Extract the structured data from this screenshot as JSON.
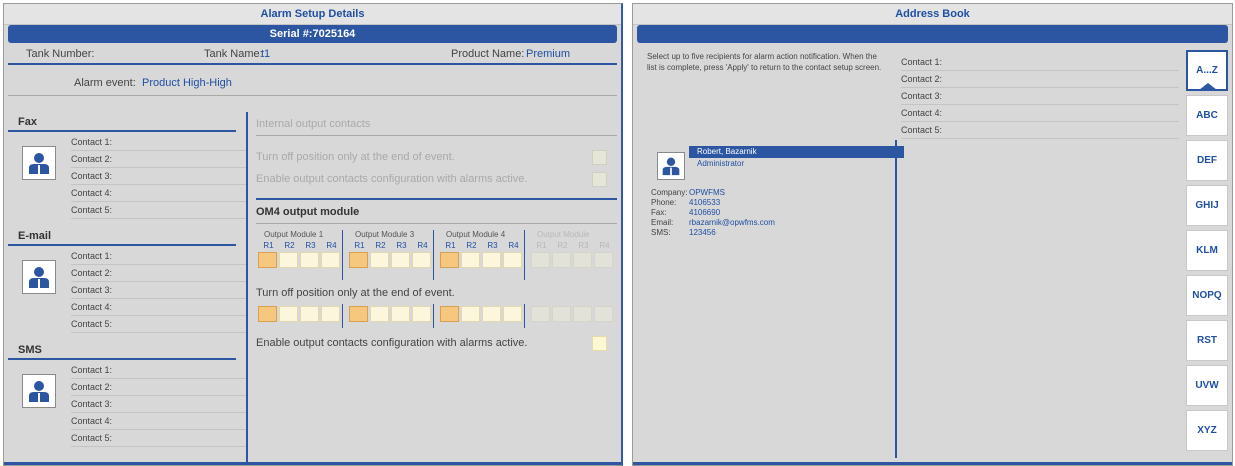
{
  "alarm_setup": {
    "title": "Alarm Setup Details",
    "serial": "Serial #:7025164",
    "tank_number_label": "Tank Number:",
    "tank_name_label": "Tank Name:",
    "tank_name_value": "t1",
    "product_name_label": "Product Name:",
    "product_name_value": "Premium",
    "alarm_event_label": "Alarm event:",
    "alarm_event_value": "Product High-High"
  },
  "notify": {
    "fax": {
      "label": "Fax",
      "contacts": [
        "Contact 1:",
        "Contact 2:",
        "Contact 3:",
        "Contact 4:",
        "Contact 5:"
      ]
    },
    "email": {
      "label": "E-mail",
      "contacts": [
        "Contact 1:",
        "Contact 2:",
        "Contact 3:",
        "Contact 4:",
        "Contact 5:"
      ]
    },
    "sms": {
      "label": "SMS",
      "contacts": [
        "Contact 1:",
        "Contact 2:",
        "Contact 3:",
        "Contact 4:",
        "Contact 5:"
      ]
    }
  },
  "internal": {
    "title": "Internal output contacts",
    "opt1": "Turn off position only at the end of event.",
    "opt2": "Enable output contacts configuration with alarms active."
  },
  "om4": {
    "title": "OM4 output module",
    "modules": [
      "Output Module 1",
      "Output Module 3",
      "Output Module 4",
      "Output Module"
    ],
    "relays": [
      "R1",
      "R2",
      "R3",
      "R4"
    ],
    "turn_off_label": "Turn off position only at the end of event.",
    "enable_label": "Enable output contacts configuration with alarms active."
  },
  "address_book": {
    "title": "Address Book",
    "description": "Select up to five recipients for alarm action notification. When the list is complete, press 'Apply' to return to the contact setup screen.",
    "contacts": [
      "Contact 1:",
      "Contact 2:",
      "Contact 3:",
      "Contact 4:",
      "Contact 5:"
    ],
    "entry": {
      "name": "Robert, Bazarnik",
      "role": "Administrator",
      "company_label": "Company:",
      "company": "OPWFMS",
      "phone_label": "Phone:",
      "phone": "4106533",
      "fax_label": "Fax:",
      "fax": "4106690",
      "email_label": "Email:",
      "email": "rbazarnik@opwfms.com",
      "sms_label": "SMS:",
      "sms": "123456"
    },
    "alpha_tabs": [
      "A...Z",
      "ABC",
      "DEF",
      "GHIJ",
      "KLM",
      "NOPQ",
      "RST",
      "UVW",
      "XYZ"
    ]
  },
  "colors": {
    "accent": "#2c56a2",
    "selected_relay": "#f6c77e",
    "panel_bg": "#d8d8d8"
  }
}
